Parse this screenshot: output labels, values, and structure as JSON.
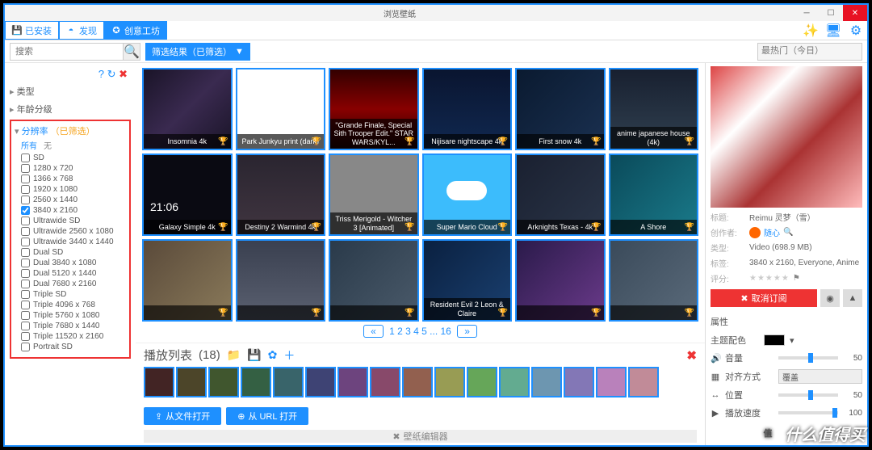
{
  "window": {
    "title": "浏览壁纸"
  },
  "tabs": {
    "installed": "已安装",
    "discover": "发现",
    "workshop": "创意工坊"
  },
  "search": {
    "placeholder": "搜索",
    "filter_chip": "筛选结果（已筛选）"
  },
  "sort": {
    "selected": "最热门（今日）"
  },
  "sidebar": {
    "categories": [
      "类型",
      "年龄分级"
    ],
    "resolution": {
      "header": "分辨率",
      "selected_label": "（已筛选）",
      "all": "所有",
      "none": "无",
      "options": [
        {
          "label": "SD",
          "checked": false
        },
        {
          "label": "1280 x 720",
          "checked": false
        },
        {
          "label": "1366 x 768",
          "checked": false
        },
        {
          "label": "1920 x 1080",
          "checked": false
        },
        {
          "label": "2560 x 1440",
          "checked": false
        },
        {
          "label": "3840 x 2160",
          "checked": true
        },
        {
          "label": "Ultrawide SD",
          "checked": false
        },
        {
          "label": "Ultrawide 2560 x 1080",
          "checked": false
        },
        {
          "label": "Ultrawide 3440 x 1440",
          "checked": false
        },
        {
          "label": "Dual SD",
          "checked": false
        },
        {
          "label": "Dual 3840 x 1080",
          "checked": false
        },
        {
          "label": "Dual 5120 x 1440",
          "checked": false
        },
        {
          "label": "Dual 7680 x 2160",
          "checked": false
        },
        {
          "label": "Triple SD",
          "checked": false
        },
        {
          "label": "Triple 4096 x 768",
          "checked": false
        },
        {
          "label": "Triple 5760 x 1080",
          "checked": false
        },
        {
          "label": "Triple 7680 x 1440",
          "checked": false
        },
        {
          "label": "Triple 11520 x 2160",
          "checked": false
        },
        {
          "label": "Portrait SD",
          "checked": false
        }
      ]
    }
  },
  "grid": {
    "items": [
      {
        "title": "Insomnia 4k",
        "bg": "linear-gradient(135deg,#1a1428,#3a2a50,#1a1428)"
      },
      {
        "title": "Park Junkyu print (dark)",
        "bg": "#fff"
      },
      {
        "title": "\"Grande Finale, Special Sith Trooper Edit.\" STAR WARS/KYL...",
        "bg": "linear-gradient(180deg,#300,#800,#200)"
      },
      {
        "title": "Nijisare nightscape 4k",
        "bg": "linear-gradient(180deg,#0a1530,#102850)"
      },
      {
        "title": "First snow 4k",
        "bg": "linear-gradient(135deg,#0a1a30,#1a3050)"
      },
      {
        "title": "anime japanese house (4k)",
        "bg": "linear-gradient(180deg,#182030,#304050)"
      },
      {
        "title": "Galaxy Simple 4k",
        "bg": "#0a0a12",
        "extra": "21:06"
      },
      {
        "title": "Destiny 2 Warmind 4k",
        "bg": "linear-gradient(180deg,#2a2530,#403540)"
      },
      {
        "title": "Triss Merigold - Witcher 3 [Animated]",
        "bg": "#888"
      },
      {
        "title": "Super Mario Cloud",
        "bg": "#3cbcfc",
        "extra": "cloud"
      },
      {
        "title": "Arknights Texas - 4k",
        "bg": "linear-gradient(135deg,#1a2030,#2a3548)"
      },
      {
        "title": "A Shore",
        "bg": "linear-gradient(135deg,#0a4a5a,#1a7a8a)"
      },
      {
        "title": "",
        "bg": "linear-gradient(135deg,#5a4a3a,#8a7a5a)"
      },
      {
        "title": "",
        "bg": "linear-gradient(180deg,#3a4050,#5a6070)"
      },
      {
        "title": "",
        "bg": "linear-gradient(135deg,#2a3a4a,#4a5a6a)"
      },
      {
        "title": "Resident Evil 2 Leon & Claire",
        "bg": "linear-gradient(135deg,#0a2040,#1a4070)"
      },
      {
        "title": "",
        "bg": "linear-gradient(135deg,#2a1a4a,#6a3a8a)"
      },
      {
        "title": "",
        "bg": "linear-gradient(135deg,#3a4a5a,#5a6a7a)"
      }
    ]
  },
  "pager": {
    "pages": "1 2 3 4 5 ... 16"
  },
  "playlist": {
    "title": "播放列表",
    "count": "(18)",
    "thumbs": 16
  },
  "buttons": {
    "from_file": "从文件打开",
    "from_url": "从 URL 打开",
    "editor": "壁纸编辑器"
  },
  "details": {
    "title_k": "标题:",
    "title_v": "Reimu 灵梦（雪）",
    "author_k": "创作者:",
    "author_v": "随心",
    "type_k": "类型:",
    "type_v": "Video (698.9 MB)",
    "tags_k": "标签:",
    "tags_v": "3840 x 2160, Everyone, Anime",
    "rating_k": "评分:",
    "unsubscribe": "取消订阅",
    "props_header": "属性",
    "scheme": "主题配色",
    "volume": "音量",
    "volume_val": "50",
    "align": "对齐方式",
    "align_val": "覆盖",
    "position": "位置",
    "position_val": "50",
    "speed": "播放速度",
    "speed_val": "100"
  },
  "watermark": "什么值得买"
}
